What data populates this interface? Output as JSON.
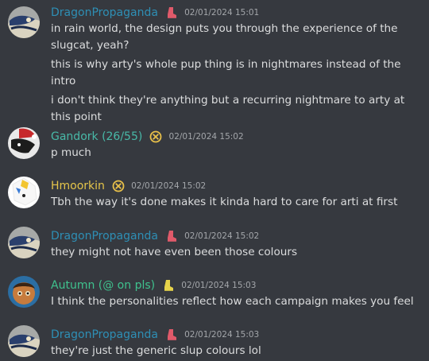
{
  "colors": {
    "background": "#36393f",
    "text": "#dcddde",
    "timestamp": "#a3a6aa",
    "dragon_name": "#2e8fb5",
    "gandork_name": "#48b9a8",
    "hmoorkin_name": "#e5c54a",
    "autumn_name": "#3fc28e"
  },
  "messages": [
    {
      "username": "DragonPropaganda",
      "badge": "boot-icon",
      "timestamp": "02/01/2024 15:01",
      "lines": [
        "in rain world, the design puts you through the experience of the slugcat, yeah?",
        "this is why arty's whole pup thing is in nightmares instead of the intro",
        "i don't think they're anything but a recurring nightmare to arty at this point"
      ]
    },
    {
      "username": "Gandork (26/55)",
      "badge": "circle-x-icon",
      "timestamp": "02/01/2024 15:02",
      "lines": [
        "p much"
      ]
    },
    {
      "username": "Hmoorkin",
      "badge": "circle-x-icon",
      "timestamp": "02/01/2024 15:02",
      "lines": [
        "Tbh the way it's done makes it kinda hard to care for arti at first"
      ]
    },
    {
      "username": "DragonPropaganda",
      "badge": "boot-icon",
      "timestamp": "02/01/2024 15:02",
      "lines": [
        "they might not have even been those colours"
      ]
    },
    {
      "username": "Autumn (@ on pls)",
      "badge": "boot-icon",
      "timestamp": "02/01/2024 15:03",
      "lines": [
        "I think the personalities reflect how each campaign makes you feel"
      ]
    },
    {
      "username": "DragonPropaganda",
      "badge": "boot-icon",
      "timestamp": "02/01/2024 15:03",
      "lines": [
        "they're just the generic slup colours lol"
      ]
    }
  ]
}
